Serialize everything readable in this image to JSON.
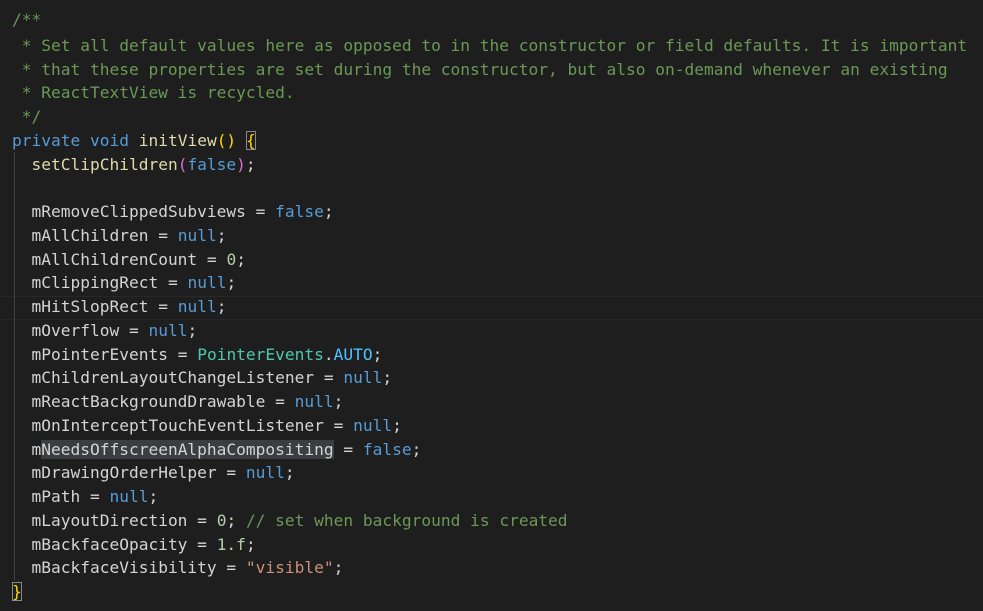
{
  "editor": {
    "colors": {
      "background": "#1e1e1e",
      "comment": "#6a9955",
      "keyword": "#569cd6",
      "function": "#dcdcaa",
      "type": "#4ec9b0",
      "constant": "#4fc1ff",
      "number": "#b5cea8",
      "string": "#ce9178",
      "text": "#d4d4d4"
    },
    "lines": {
      "l1": "/**",
      "l2": " * Set all default values here as opposed to in the constructor or field defaults. It is important",
      "l3": " * that these properties are set during the constructor, but also on-demand whenever an existing",
      "l4": " * ReactTextView is recycled.",
      "l5": " */",
      "l6": {
        "kw_private": "private",
        "kw_void": "void",
        "fn_name": "initView",
        "parens": "()",
        "brace_open": "{"
      },
      "l7": {
        "indent": "  ",
        "fn": "setClipChildren",
        "p_open": "(",
        "arg": "false",
        "p_close": ")",
        "semi": ";"
      },
      "l9": {
        "indent": "  ",
        "var": "mRemoveClippedSubviews",
        "op": " = ",
        "val": "false",
        "semi": ";"
      },
      "l10": {
        "indent": "  ",
        "var": "mAllChildren",
        "op": " = ",
        "val": "null",
        "semi": ";"
      },
      "l11": {
        "indent": "  ",
        "var": "mAllChildrenCount",
        "op": " = ",
        "val": "0",
        "semi": ";"
      },
      "l12": {
        "indent": "  ",
        "var": "mClippingRect",
        "op": " = ",
        "val": "null",
        "semi": ";"
      },
      "l13": {
        "indent": "  ",
        "var": "mHitSlopRect",
        "op": " = ",
        "val": "null",
        "semi": ";"
      },
      "l14": {
        "indent": "  ",
        "var": "mOverflow",
        "op": " = ",
        "val": "null",
        "semi": ";"
      },
      "l15": {
        "indent": "  ",
        "var": "mPointerEvents",
        "op": " = ",
        "cls": "PointerEvents",
        "dot": ".",
        "member": "AUTO",
        "semi": ";"
      },
      "l16": {
        "indent": "  ",
        "var": "mChildrenLayoutChangeListener",
        "op": " = ",
        "val": "null",
        "semi": ";"
      },
      "l17": {
        "indent": "  ",
        "var": "mReactBackgroundDrawable",
        "op": " = ",
        "val": "null",
        "semi": ";"
      },
      "l18": {
        "indent": "  ",
        "var": "mOnInterceptTouchEventListener",
        "op": " = ",
        "val": "null",
        "semi": ";"
      },
      "l19": {
        "indent": "  ",
        "var_prefix": "m",
        "var_selected": "NeedsOffscreenAlphaCompositing",
        "op": " = ",
        "val": "false",
        "semi": ";"
      },
      "l20": {
        "indent": "  ",
        "var": "mDrawingOrderHelper",
        "op": " = ",
        "val": "null",
        "semi": ";"
      },
      "l21": {
        "indent": "  ",
        "var": "mPath",
        "op": " = ",
        "val": "null",
        "semi": ";"
      },
      "l22": {
        "indent": "  ",
        "var": "mLayoutDirection",
        "op": " = ",
        "val": "0",
        "semi": "; ",
        "comment": "// set when background is created"
      },
      "l23": {
        "indent": "  ",
        "var": "mBackfaceOpacity",
        "op": " = ",
        "val": "1.f",
        "semi": ";"
      },
      "l24": {
        "indent": "  ",
        "var": "mBackfaceVisibility",
        "op": " = ",
        "val": "\"visible\"",
        "semi": ";"
      },
      "l25": {
        "brace_close": "}"
      }
    }
  }
}
